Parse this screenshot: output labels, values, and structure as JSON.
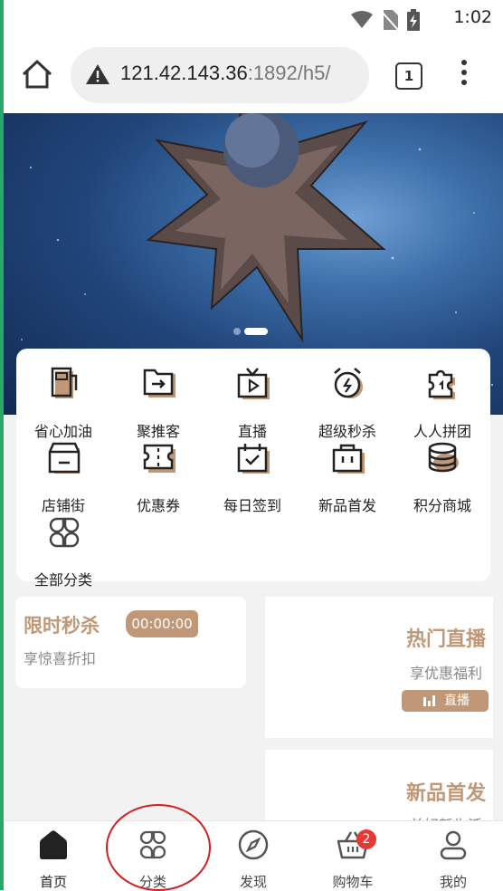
{
  "status_bar": {
    "time": "1:02"
  },
  "browser": {
    "url_host": "121.42.143.36",
    "url_rest": ":1892/h5/",
    "tab_count": "1"
  },
  "banner": {
    "slide_count": 2,
    "active_slide": 2
  },
  "shortcuts": [
    {
      "label": "省心加油",
      "icon": "gas-pump-icon"
    },
    {
      "label": "聚推客",
      "icon": "share-folder-icon"
    },
    {
      "label": "直播",
      "icon": "tv-play-icon"
    },
    {
      "label": "超级秒杀",
      "icon": "alarm-clock-icon"
    },
    {
      "label": "人人拼团",
      "icon": "puzzle-icon"
    },
    {
      "label": "店铺街",
      "icon": "store-icon"
    },
    {
      "label": "优惠券",
      "icon": "ticket-icon"
    },
    {
      "label": "每日签到",
      "icon": "calendar-check-icon"
    },
    {
      "label": "新品首发",
      "icon": "bag-icon"
    },
    {
      "label": "积分商城",
      "icon": "coins-icon"
    },
    {
      "label": "全部分类",
      "icon": "grid-icon"
    }
  ],
  "flash_sale": {
    "title": "限时秒杀",
    "timer": "00:00:00",
    "subtitle": "享惊喜折扣"
  },
  "hot_live": {
    "title": "热门直播",
    "subtitle": "享优惠福利",
    "badge": "直播"
  },
  "new_arrivals": {
    "title": "新品首发",
    "subtitle": "美好新生活"
  },
  "tabbar": [
    {
      "label": "首页",
      "icon": "home-icon",
      "active": true
    },
    {
      "label": "分类",
      "icon": "category-icon"
    },
    {
      "label": "发现",
      "icon": "compass-icon"
    },
    {
      "label": "购物车",
      "icon": "cart-icon",
      "badge": "2"
    },
    {
      "label": "我的",
      "icon": "user-icon"
    }
  ],
  "colors": {
    "accent": "#c09878",
    "badge": "#e53935",
    "annotation": "#d32020"
  }
}
